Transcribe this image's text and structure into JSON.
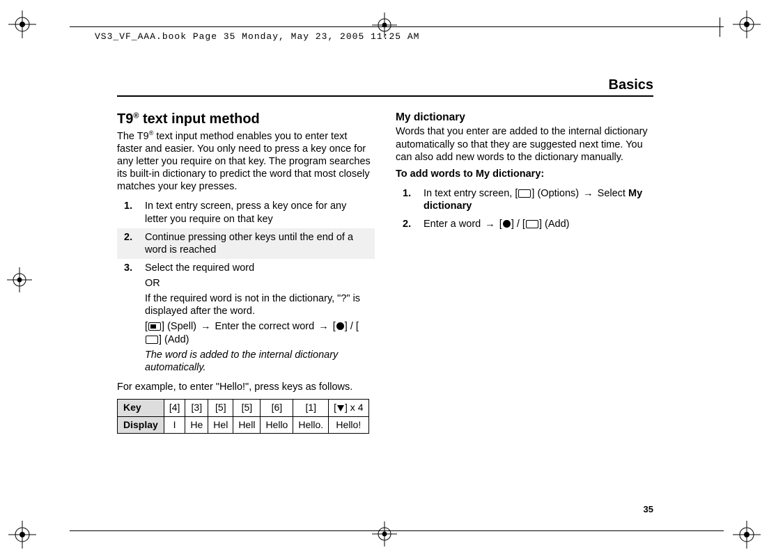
{
  "file_header": "VS3_VF_AAA.book  Page 35  Monday, May 23, 2005  11:25 AM",
  "section_title": "Basics",
  "page_number": "35",
  "left": {
    "heading_prefix": "T9",
    "heading_suffix": " text input method",
    "intro_prefix": "The T9",
    "intro_suffix": " text input method enables you to enter text faster and easier. You only need to press a key once for any letter you require on that key. The program searches its built-in dictionary to predict the word that most closely matches your key presses.",
    "steps": [
      {
        "num": "1.",
        "text": "In text entry screen, press a key once for any letter you require on that key"
      },
      {
        "num": "2.",
        "text": "Continue pressing other keys until the end of a word is reached"
      },
      {
        "num": "3.",
        "text": "Select the required word",
        "or_label": "OR",
        "after_or": "If the required word is not in the dictionary, \"?\" is displayed after the word.",
        "spell_open": "[",
        "spell_close": "] (Spell) ",
        "spell_mid": " Enter the correct word ",
        "spell_add": "] (Add)",
        "note": "The word is added to the internal dictionary automatically."
      }
    ],
    "example_intro": "For example, to enter \"Hello!\", press keys as follows.",
    "table": {
      "row_labels": [
        "Key",
        "Display"
      ],
      "keys": [
        "[4]",
        "[3]",
        "[5]",
        "[5]",
        "[6]",
        "[1]"
      ],
      "last_key_suffix": " x 4",
      "displays": [
        "I",
        "He",
        "Hel",
        "Hell",
        "Hello",
        "Hello.",
        "Hello!"
      ]
    }
  },
  "right": {
    "heading": "My dictionary",
    "intro": "Words that you enter are added to the internal dictionary automatically so that they are suggested next time. You can also add new words to the dictionary manually.",
    "subhead": "To add words to My dictionary:",
    "steps": [
      {
        "num": "1.",
        "pre": "In text entry screen, [",
        "mid": "] (Options) ",
        "post": " Select ",
        "bold": "My dictionary"
      },
      {
        "num": "2.",
        "pre": "Enter a word ",
        "add": "] (Add)"
      }
    ]
  }
}
